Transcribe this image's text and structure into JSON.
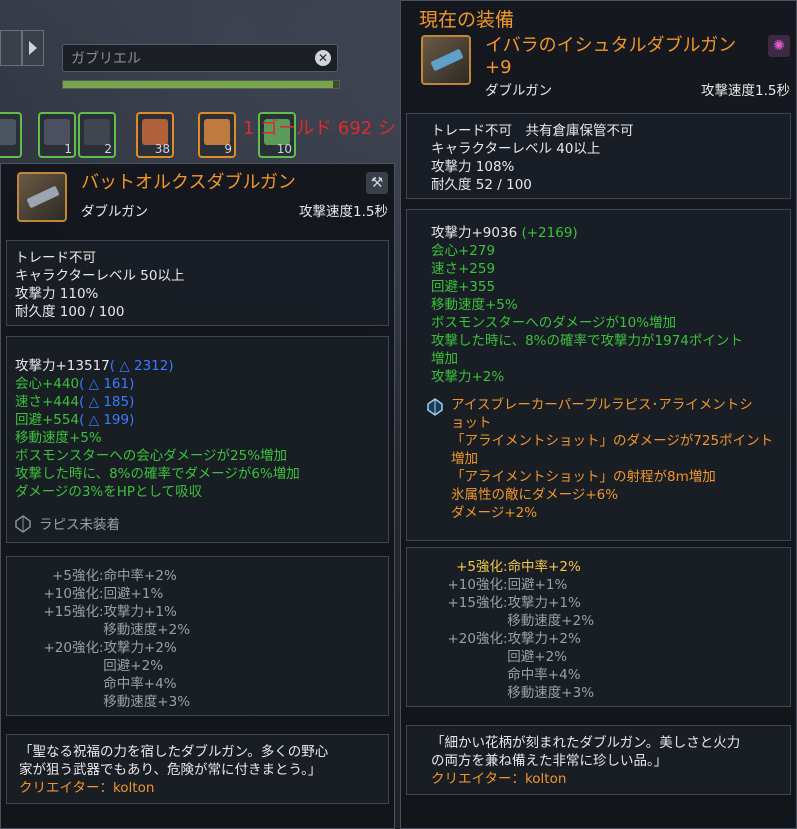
{
  "background": {
    "character_name": "ガブリエル",
    "clear_icon": "close-icon",
    "hp_fill_percent": 98,
    "gold_text": "1 ゴールド 692 シ",
    "slots": [
      {
        "count": "",
        "color": "green"
      },
      {
        "count": "1",
        "color": "green"
      },
      {
        "count": "2",
        "color": "green"
      },
      {
        "count": "38",
        "color": "orange"
      },
      {
        "count": "9",
        "color": "orange"
      },
      {
        "count": "10",
        "color": "green"
      }
    ]
  },
  "left": {
    "name": "バットオルクスダブルガン",
    "type": "ダブルガン",
    "speed": "攻撃速度1.5秒",
    "grade_icon": "weapon-grade-icon",
    "basic": [
      "トレード不可",
      "キャラクターレベル 50以上",
      "攻撃力 110%",
      "耐久度 100 / 100"
    ],
    "stats": [
      {
        "text": "攻撃力+13517",
        "diff": "( △ 2312)",
        "color": "white"
      },
      {
        "text": "会心+440",
        "diff": "( △ 161)",
        "color": "green"
      },
      {
        "text": "速さ+444",
        "diff": "( △ 185)",
        "color": "green"
      },
      {
        "text": "回避+554",
        "diff": "( △ 199)",
        "color": "green"
      }
    ],
    "effects": [
      "移動速度+5%",
      "ボスモンスターへの会心ダメージが25%増加",
      "攻撃した時に、8%の確率でダメージが6%増加",
      "ダメージの3%をHPとして吸収"
    ],
    "lapis": "ラピス未装着",
    "enhance": [
      {
        "k": "+5強化",
        "v": [
          "命中率+2%"
        ]
      },
      {
        "k": "+10強化",
        "v": [
          "回避+1%"
        ]
      },
      {
        "k": "+15強化",
        "v": [
          "攻撃力+1%",
          "移動速度+2%"
        ]
      },
      {
        "k": "+20強化",
        "v": [
          "攻撃力+2%",
          "回避+2%",
          "命中率+4%",
          "移動速度+3%"
        ]
      }
    ],
    "desc": [
      "「聖なる祝福の力を宿したダブルガン。多くの野心",
      "家が狙う武器でもあり、危険が常に付きまとう。」"
    ],
    "creator": "クリエイター：kolton"
  },
  "right": {
    "heading": "現在の装備",
    "name": "イバラのイシュタルダブルガン",
    "plus": "+9",
    "type": "ダブルガン",
    "speed": "攻撃速度1.5秒",
    "grade_icon": "weapon-grade-icon",
    "basic": [
      "トレード不可　共有倉庫保管不可",
      "キャラクターレベル 40以上",
      "攻撃力 108%",
      "耐久度 52 / 100"
    ],
    "attack": "攻撃力+9036",
    "attack_bonus": "(+2169)",
    "stats": [
      "会心+279",
      "速さ+259",
      "回避+355",
      "移動速度+5%",
      "ボスモンスターへのダメージが10%増加",
      "攻撃した時に、8%の確率で攻撃力が1974ポイント",
      "増加",
      "攻撃力+2%"
    ],
    "lapis_lines": [
      "アイスブレーカーパープルラピス･アライメントシ",
      "ョット",
      "「アライメントショット」のダメージが725ポイント",
      "増加",
      "「アライメントショット」の射程が8m増加",
      "氷属性の敵にダメージ+6%",
      "ダメージ+2%"
    ],
    "enhance": [
      {
        "k": "+5強化",
        "v": [
          "命中率+2%"
        ],
        "active": true
      },
      {
        "k": "+10強化",
        "v": [
          "回避+1%"
        ]
      },
      {
        "k": "+15強化",
        "v": [
          "攻撃力+1%",
          "移動速度+2%"
        ]
      },
      {
        "k": "+20強化",
        "v": [
          "攻撃力+2%",
          "回避+2%",
          "命中率+4%",
          "移動速度+3%"
        ]
      }
    ],
    "desc": [
      "「細かい花柄が刻まれたダブルガン。美しさと火力",
      "の両方を兼ね備えた非常に珍しい品。」"
    ],
    "creator": "クリエイター：kolton"
  }
}
